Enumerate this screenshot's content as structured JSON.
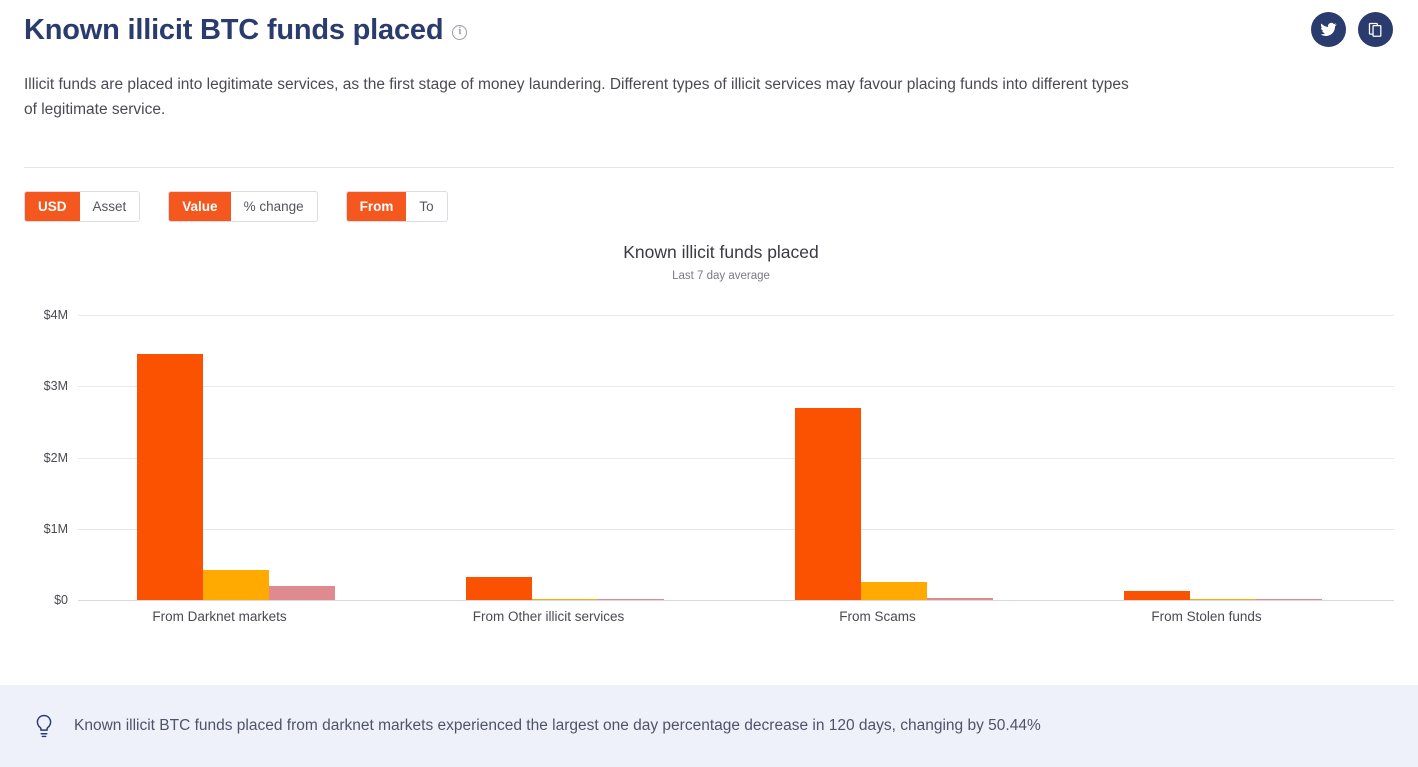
{
  "header": {
    "title": "Known illicit BTC funds placed",
    "info_icon": "info-circle-icon",
    "subtitle": "Illicit funds are placed into legitimate services, as the first stage of money laundering. Different types of illicit services may favour placing funds into different types of legitimate service.",
    "share_buttons": [
      {
        "name": "twitter-icon",
        "label": "Twitter"
      },
      {
        "name": "copy-icon",
        "label": "Copy"
      }
    ]
  },
  "toggles": [
    {
      "name": "currency-toggle",
      "options": [
        {
          "label": "USD",
          "active": true
        },
        {
          "label": "Asset",
          "active": false
        }
      ]
    },
    {
      "name": "metric-toggle",
      "options": [
        {
          "label": "Value",
          "active": true
        },
        {
          "label": "% change",
          "active": false
        }
      ]
    },
    {
      "name": "direction-toggle",
      "options": [
        {
          "label": "From",
          "active": true
        },
        {
          "label": "To",
          "active": false
        }
      ]
    }
  ],
  "chart_data": {
    "type": "bar",
    "title": "Known illicit funds placed",
    "subtitle": "Last 7 day average",
    "xlabel": "",
    "ylabel": "",
    "ylim": [
      0,
      4000000
    ],
    "yticks": [
      0,
      1000000,
      2000000,
      3000000,
      4000000
    ],
    "ytick_labels": [
      "$0",
      "$1M",
      "$2M",
      "$3M",
      "$4M"
    ],
    "grid": true,
    "legend": "none",
    "categories": [
      "From Darknet markets",
      "From Other illicit services",
      "From Scams",
      "From Stolen funds"
    ],
    "series": [
      {
        "name": "Series 1",
        "color": "#FA5200",
        "values": [
          3450000,
          330000,
          2700000,
          120000
        ]
      },
      {
        "name": "Series 2",
        "color": "#FFAA00",
        "values": [
          420000,
          20000,
          250000,
          15000
        ]
      },
      {
        "name": "Series 3",
        "color": "#DE8A8E",
        "values": [
          190000,
          14000,
          35000,
          10000
        ]
      }
    ]
  },
  "insight": {
    "icon": "lightbulb-icon",
    "text": "Known illicit BTC funds placed from darknet markets experienced the largest one day percentage decrease in 120 days, changing by 50.44%"
  },
  "colors": {
    "accent": "#F5581E",
    "title": "#2a3b6e",
    "insight_bg": "#eff1fa"
  }
}
